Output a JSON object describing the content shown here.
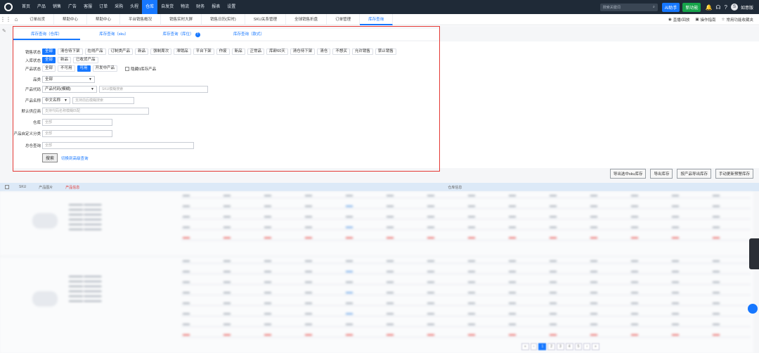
{
  "topnav": {
    "items": [
      "首页",
      "产品",
      "销售",
      "广告",
      "客服",
      "订单",
      "采购",
      "头程",
      "仓库",
      "自发货",
      "物流",
      "财务",
      "报表",
      "设置"
    ],
    "active_index": 8,
    "search_placeholder": "搜索关键词",
    "ai_label": "AI助手",
    "new_label": "新功能",
    "user_initial": "S",
    "user_name": "如意版"
  },
  "tabs": {
    "items": [
      "订单出货",
      "帮助中心",
      "帮助中心",
      "平台销售概况",
      "销售实时大屏",
      "销售日历(实时)",
      "SKU关系管理",
      "全球销售折盘",
      "订单管理",
      "库存查询"
    ],
    "active_index": 9,
    "right": [
      "直播/回放",
      "操作指南",
      "常用功能收藏夹"
    ]
  },
  "subtabs": [
    "库存查询（仓库）",
    "库存查询（sku）",
    "库存查询（库位）",
    "库存查询（款式）"
  ],
  "filters": {
    "sales_status": {
      "label": "销售状态",
      "options": [
        "全部",
        "清仓待下架",
        "在线产品",
        "订制类产品",
        "新品",
        "强制周次",
        "滞销品",
        "平台下架",
        "作废",
        "新品",
        "正常品",
        "库龄60天",
        "清仓待下架",
        "清仓",
        "不想买",
        "允许销售",
        "禁止销售"
      ]
    },
    "inbound_status": {
      "label": "入库状态",
      "options": [
        "全部",
        "新品",
        "已收货产品"
      ]
    },
    "product_status": {
      "label": "产品状态",
      "options": [
        "全部",
        "不可用",
        "可用",
        "开发中产品"
      ],
      "hide_zero": "隐藏0库存产品"
    },
    "category": {
      "label": "品类",
      "value": "全部"
    },
    "code": {
      "label": "产品代码",
      "select": "产品代码(模糊)",
      "placeholder": "SKU模糊搜索"
    },
    "name": {
      "label": "产品名称",
      "select": "中文名称",
      "placeholder": "支持前后模糊搜索"
    },
    "supplier": {
      "label": "默认供应商",
      "placeholder": "支持代码名称模糊匹配"
    },
    "warehouse": {
      "label": "仓库",
      "placeholder": "全部"
    },
    "custom_category": {
      "label": "产品自定义分类",
      "placeholder": "全部"
    },
    "general": {
      "label": "总仓查询",
      "placeholder": "全部"
    },
    "search_button": "搜索",
    "advanced_link": "切换到高级查询"
  },
  "actions": [
    "导出选中sku库存",
    "导出库存",
    "按产品导出库存",
    "手动更新预警库存"
  ],
  "table_head": [
    "SKU",
    "产品图片",
    "产品信息",
    "仓库信息"
  ]
}
